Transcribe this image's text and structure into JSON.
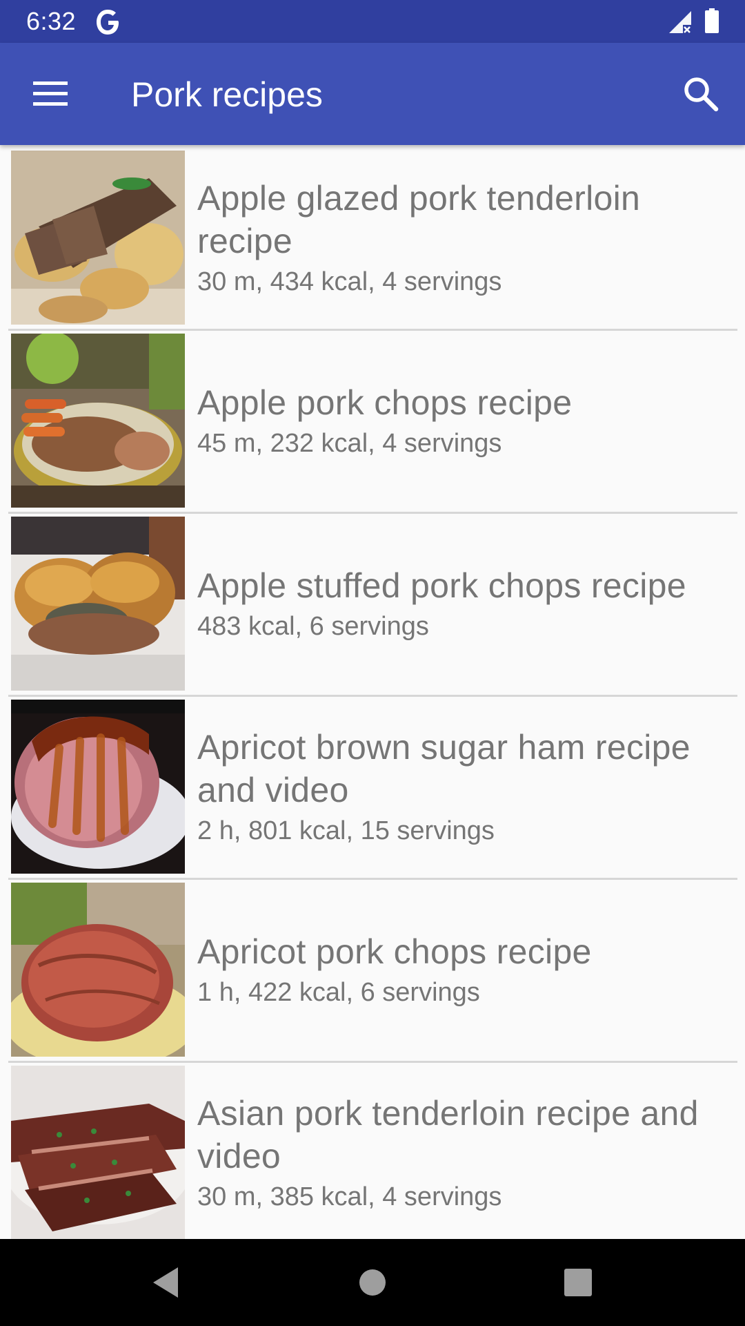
{
  "status_bar": {
    "time": "6:32",
    "icons": [
      "google-g-icon",
      "signal-no-data-icon",
      "battery-full-icon"
    ]
  },
  "app_bar": {
    "title": "Pork recipes",
    "menu_icon": "hamburger-menu-icon",
    "search_icon": "search-icon",
    "background_color": "#3f51b5",
    "status_bar_color": "#303f9f"
  },
  "recipes": [
    {
      "title": "Apple glazed pork tenderloin recipe",
      "meta": "30 m, 434 kcal, 4 servings"
    },
    {
      "title": "Apple pork chops recipe",
      "meta": "45 m, 232 kcal, 4 servings"
    },
    {
      "title": "Apple stuffed pork chops recipe",
      "meta": "483 kcal, 6 servings"
    },
    {
      "title": "Apricot brown sugar ham recipe and video",
      "meta": "2 h, 801 kcal, 15 servings"
    },
    {
      "title": "Apricot pork chops recipe",
      "meta": "1 h, 422 kcal, 6 servings"
    },
    {
      "title": "Asian pork tenderloin recipe and video",
      "meta": "30 m, 385 kcal, 4 servings"
    }
  ],
  "nav_bar": {
    "icons": [
      "back-triangle-icon",
      "home-circle-icon",
      "recents-square-icon"
    ]
  }
}
